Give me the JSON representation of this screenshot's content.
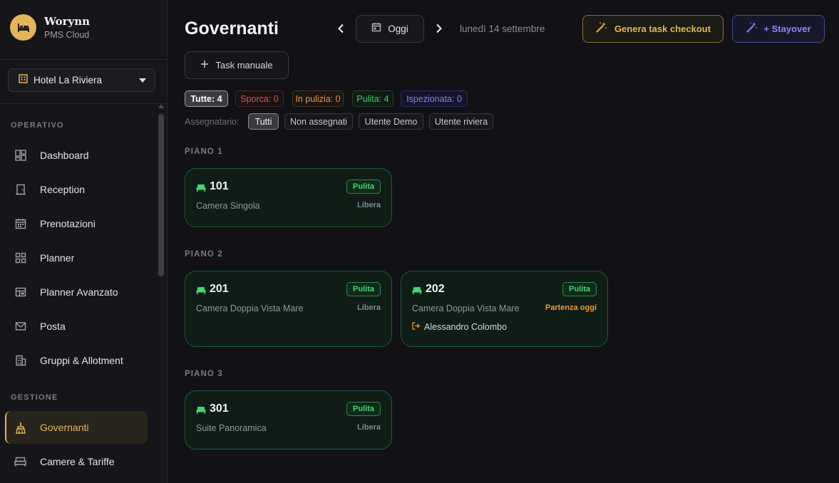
{
  "brand": {
    "name": "Worynn",
    "subtitle": "PMS Cloud"
  },
  "hotel_selector": {
    "value": "Hotel La Riviera"
  },
  "sidebar": {
    "sections": [
      {
        "title": "OPERATIVO",
        "items": [
          {
            "label": "Dashboard",
            "icon": "dashboard-icon"
          },
          {
            "label": "Reception",
            "icon": "door-icon"
          },
          {
            "label": "Prenotazioni",
            "icon": "calendar-icon"
          },
          {
            "label": "Planner",
            "icon": "grid-icon"
          },
          {
            "label": "Planner Avanzato",
            "icon": "layout-icon"
          },
          {
            "label": "Posta",
            "icon": "mail-icon"
          },
          {
            "label": "Gruppi & Allotment",
            "icon": "building-icon"
          }
        ]
      },
      {
        "title": "GESTIONE",
        "items": [
          {
            "label": "Governanti",
            "icon": "broom-icon",
            "active": true
          },
          {
            "label": "Camere & Tariffe",
            "icon": "bed-icon"
          }
        ]
      }
    ]
  },
  "header": {
    "title": "Governanti",
    "today_label": "Oggi",
    "date": "lunedì 14 settembre",
    "checkout_button": "Genera task checkout",
    "stayover_button": "+ Stayover",
    "manual_task_button": "Task manuale"
  },
  "status_filters": [
    {
      "label": "Tutte: 4",
      "selected": true
    },
    {
      "label": "Sporca: 0"
    },
    {
      "label": "In pulizia: 0"
    },
    {
      "label": "Pulita: 4"
    },
    {
      "label": "Ispezionata: 0"
    }
  ],
  "assignee": {
    "label": "Assegnatario:",
    "options": [
      {
        "label": "Tutti",
        "selected": true
      },
      {
        "label": "Non assegnati"
      },
      {
        "label": "Utente Demo"
      },
      {
        "label": "Utente riviera"
      }
    ]
  },
  "floors": [
    {
      "title": "PIANO 1",
      "rooms": [
        {
          "number": "101",
          "type": "Camera Singola",
          "status": "Pulita",
          "occupancy": "Libera"
        }
      ]
    },
    {
      "title": "PIANO 2",
      "rooms": [
        {
          "number": "201",
          "type": "Camera Doppia Vista Mare",
          "status": "Pulita",
          "occupancy": "Libera"
        },
        {
          "number": "202",
          "type": "Camera Doppia Vista Mare",
          "status": "Pulita",
          "occupancy": "Partenza oggi",
          "guest": "Alessandro Colombo"
        }
      ]
    },
    {
      "title": "PIANO 3",
      "rooms": [
        {
          "number": "301",
          "type": "Suite Panoramica",
          "status": "Pulita",
          "occupancy": "Libera"
        }
      ]
    }
  ],
  "colors": {
    "accent_gold": "#e3b55a",
    "stayover_purple": "#8c88f0",
    "clean_green": "#47d474",
    "dirty_red": "#e0504e",
    "cleaning_orange": "#eb9440",
    "departure_orange": "#ee9a36"
  }
}
